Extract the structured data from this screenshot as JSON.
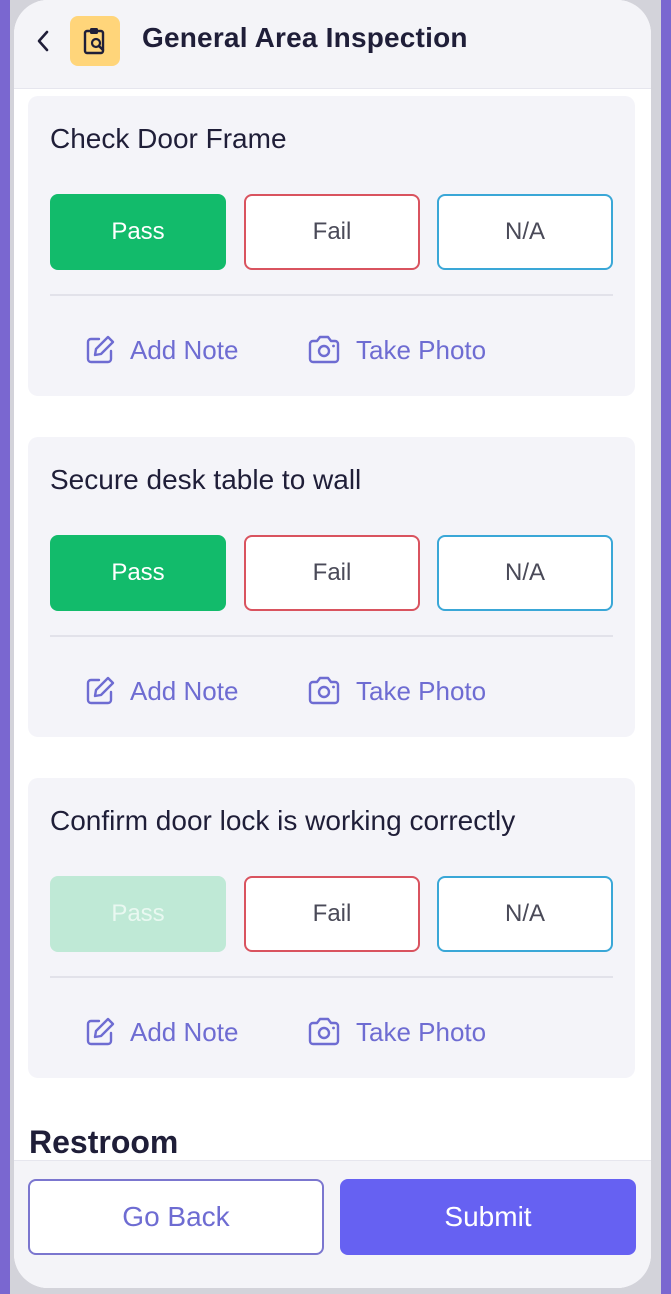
{
  "header": {
    "title": "General Area Inspection",
    "back_icon": "chevron-left-icon",
    "app_icon": "clipboard-search-icon",
    "app_icon_bg": "#ffd57a"
  },
  "checks": [
    {
      "title": "Check Door Frame",
      "pass_label": "Pass",
      "fail_label": "Fail",
      "na_label": "N/A",
      "selected": "Pass",
      "note_label": "Add Note",
      "photo_label": "Take Photo"
    },
    {
      "title": "Secure desk table to wall",
      "pass_label": "Pass",
      "fail_label": "Fail",
      "na_label": "N/A",
      "selected": "Pass",
      "note_label": "Add Note",
      "photo_label": "Take Photo"
    },
    {
      "title": "Confirm door lock is working correctly",
      "pass_label": "Pass",
      "fail_label": "Fail",
      "na_label": "N/A",
      "selected": "",
      "note_label": "Add Note",
      "photo_label": "Take Photo"
    }
  ],
  "next_section": {
    "title": "Restroom"
  },
  "footer": {
    "back_label": "Go Back",
    "submit_label": "Submit"
  },
  "colors": {
    "pass": "#12bb6b",
    "fail": "#d9535f",
    "na": "#3aa7d7",
    "accent": "#6661f2"
  }
}
